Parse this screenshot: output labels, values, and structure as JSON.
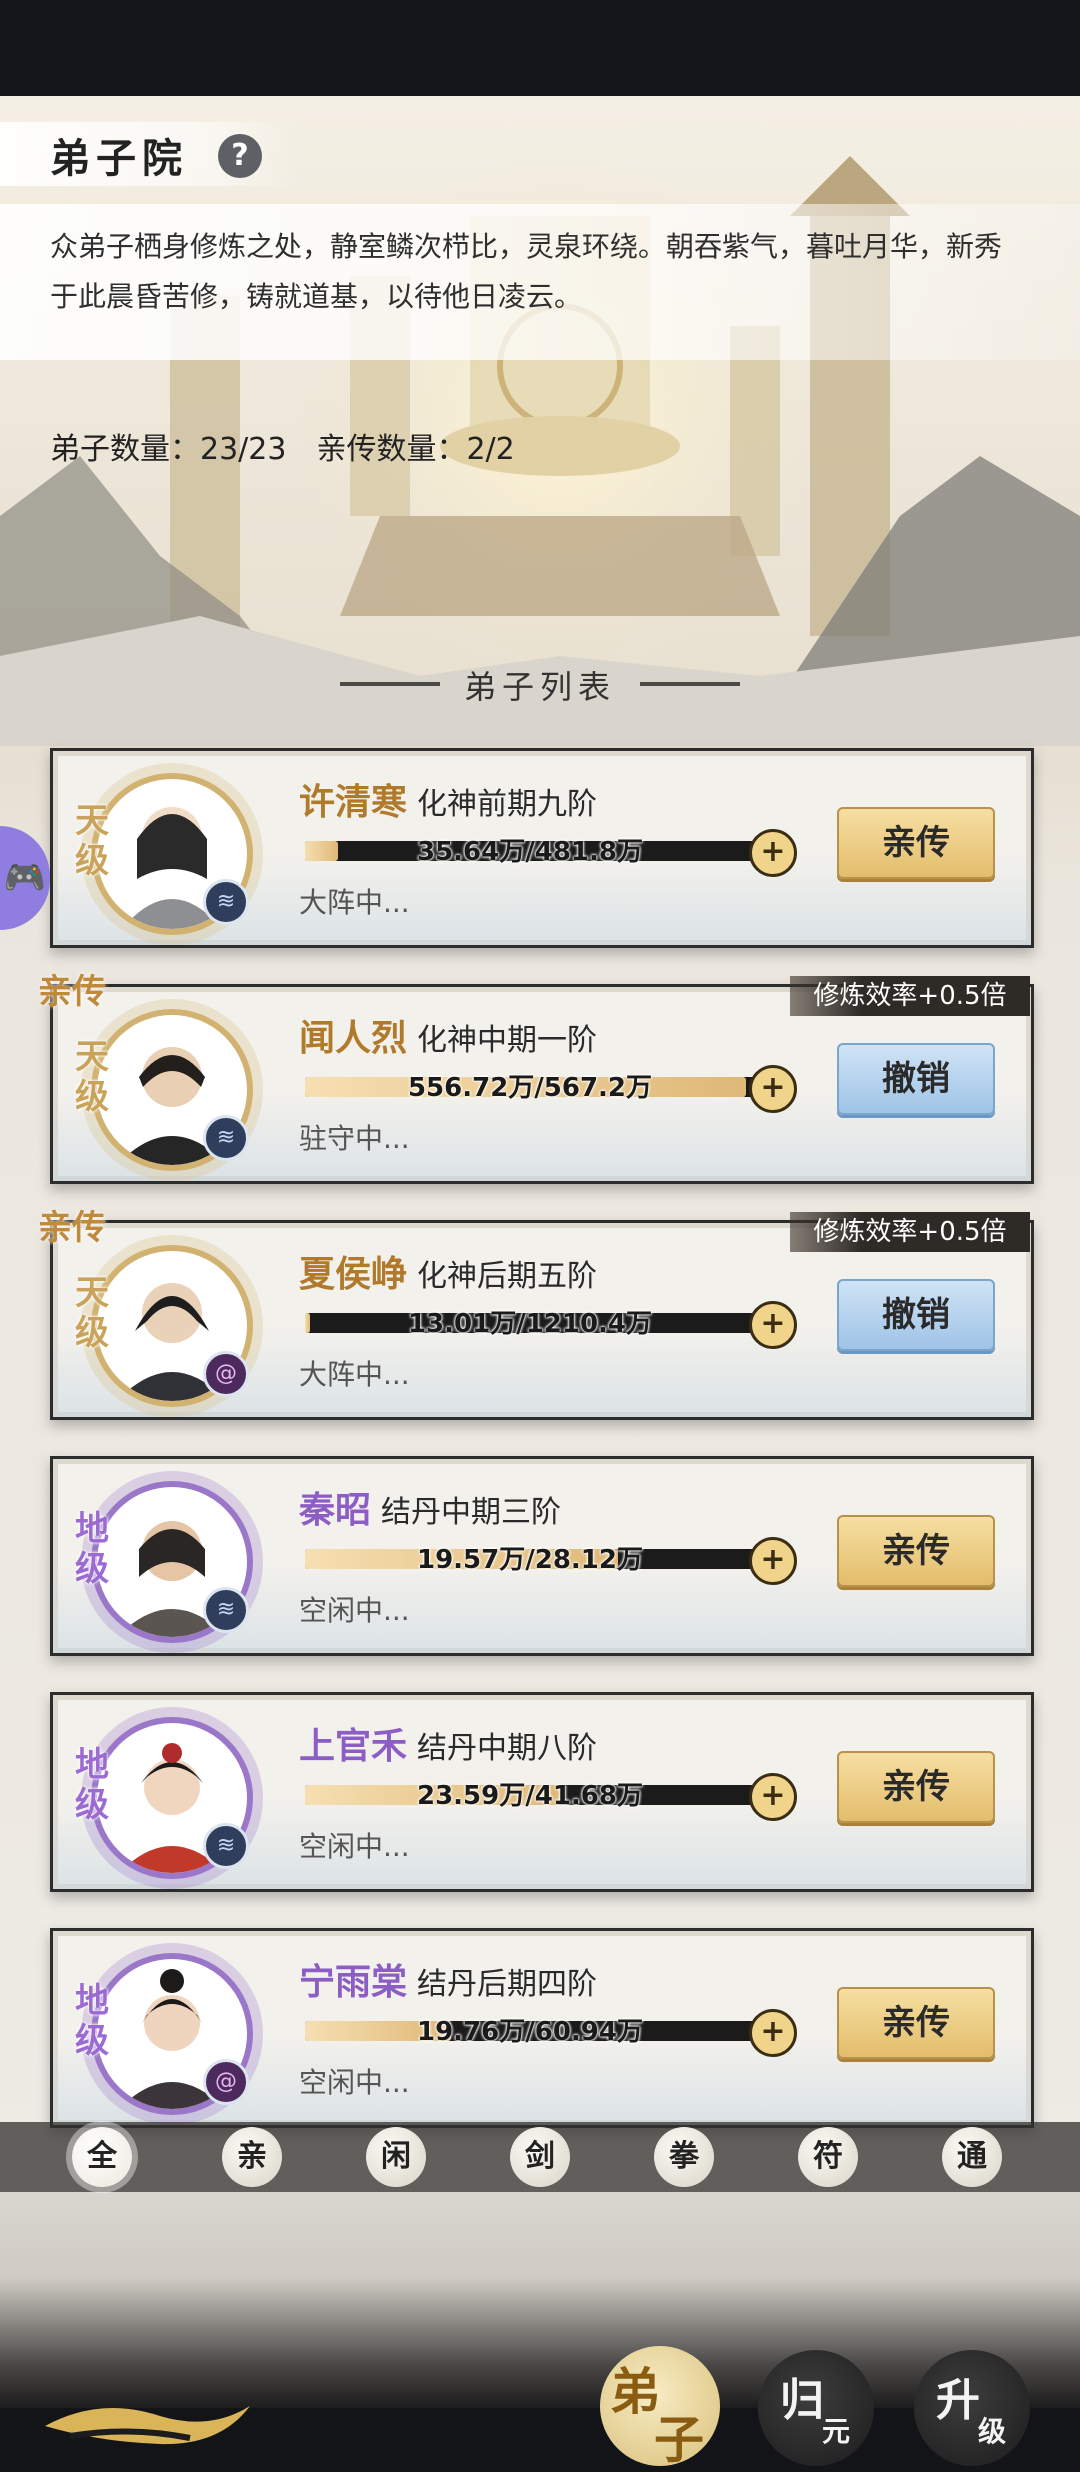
{
  "header": {
    "title": "弟子院",
    "help_icon": "?",
    "description": "众弟子栖身修炼之处，静室鳞次栉比，灵泉环绕。朝吞紫气，暮吐月华，新秀于此晨昏苦修，铸就道基，以待他日凌云。",
    "disciple_count": "弟子数量：23/23",
    "direct_count": "亲传数量：2/2",
    "list_title": "弟子列表"
  },
  "disciples": [
    {
      "grade": "天级",
      "name": "许清寒",
      "realm": "化神前期九阶",
      "progress_text": "35.64万/481.8万",
      "progress": 0.074,
      "status": "大阵中...",
      "action": "亲传",
      "tag": "",
      "rate": "",
      "element": "water-icon"
    },
    {
      "grade": "天级",
      "name": "闻人烈",
      "realm": "化神中期一阶",
      "progress_text": "556.72万/567.2万",
      "progress": 0.98,
      "status": "驻守中...",
      "action": "撤销",
      "tag": "亲传",
      "rate": "修炼效率+0.5倍",
      "element": "water-icon"
    },
    {
      "grade": "天级",
      "name": "夏侯峥",
      "realm": "化神后期五阶",
      "progress_text": "13.01万/1210.4万",
      "progress": 0.011,
      "status": "大阵中...",
      "action": "撤销",
      "tag": "亲传",
      "rate": "修炼效率+0.5倍",
      "element": "wind-icon"
    },
    {
      "grade": "地级",
      "name": "秦昭",
      "realm": "结丹中期三阶",
      "progress_text": "19.57万/28.12万",
      "progress": 0.696,
      "status": "空闲中...",
      "action": "亲传",
      "tag": "",
      "rate": "",
      "element": "water-icon"
    },
    {
      "grade": "地级",
      "name": "上官禾",
      "realm": "结丹中期八阶",
      "progress_text": "23.59万/41.68万",
      "progress": 0.566,
      "status": "空闲中...",
      "action": "亲传",
      "tag": "",
      "rate": "",
      "element": "water-icon"
    },
    {
      "grade": "地级",
      "name": "宁雨棠",
      "realm": "结丹后期四阶",
      "progress_text": "19.76万/60.94万",
      "progress": 0.324,
      "status": "空闲中...",
      "action": "亲传",
      "tag": "",
      "rate": "",
      "element": "wind-icon"
    }
  ],
  "filters": [
    "全",
    "亲",
    "闲",
    "剑",
    "拳",
    "符",
    "通"
  ],
  "nav": {
    "disciple_1": "弟",
    "disciple_2": "子",
    "return_1": "归",
    "return_2": "元",
    "upgrade_1": "升",
    "upgrade_2": "级"
  },
  "floating": {
    "game_icon": "🎮"
  }
}
